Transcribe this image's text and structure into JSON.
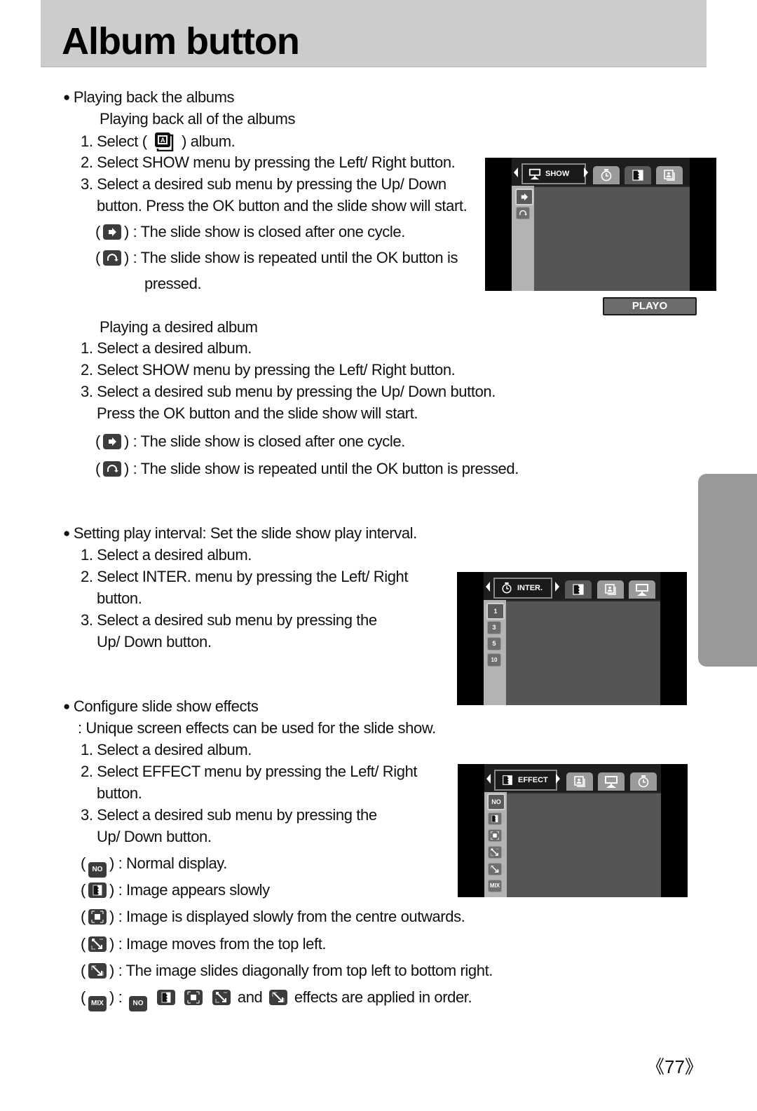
{
  "header": {
    "title": "Album button"
  },
  "section1": {
    "heading": "Playing back the albums",
    "sub1": {
      "title": "Playing back all of the albums",
      "step1_pre": "1. Select (",
      "step1_post": ") album.",
      "step2": "2. Select SHOW menu by pressing the Left/ Right button.",
      "step3a": "3. Select a desired sub menu by pressing the Up/ Down",
      "step3b": "button. Press the OK button and the slide show will start.",
      "opt1": ") : The slide show is closed after one cycle.",
      "opt2a": ") : The slide show is repeated until the OK button is",
      "opt2b": "pressed."
    },
    "sub2": {
      "title": "Playing a desired album",
      "step1": "1. Select a desired album.",
      "step2": "2. Select SHOW menu by pressing the Left/ Right button.",
      "step3a": "3. Select a desired sub menu by pressing the Up/ Down button.",
      "step3b": "Press the OK button and the slide show will start.",
      "opt1": ") : The slide show is closed after one cycle.",
      "opt2": ") : The slide show is repeated until the OK button is pressed."
    },
    "open_paren": "(",
    "screen": {
      "selected_tab": "SHOW",
      "selected_icon": "slideshow-icon",
      "tabs": [
        "timer-icon",
        "effect-icon",
        "album-icon"
      ],
      "sub_items": [
        "play-once-icon",
        "repeat-icon"
      ],
      "button": "PLAYO"
    }
  },
  "section2": {
    "heading": "Setting play interval: Set the slide show play interval.",
    "step1": "1. Select a desired album.",
    "step2a": "2. Select INTER. menu by pressing the Left/ Right",
    "step2b": "button.",
    "step3a": "3. Select a desired sub menu by pressing the",
    "step3b": "Up/ Down button.",
    "screen": {
      "selected_tab": "INTER.",
      "selected_icon": "timer-icon",
      "tabs": [
        "effect-icon",
        "album-icon",
        "slideshow-icon"
      ],
      "sub_items": [
        "1",
        "3",
        "5",
        "10"
      ]
    }
  },
  "section3": {
    "heading": "Configure slide show effects",
    "desc": ": Unique screen effects can be used for the slide show.",
    "step1": "1. Select a desired album.",
    "step2a": "2. Select EFFECT menu by pressing the Left/ Right",
    "step2b": "button.",
    "step3a": "3. Select a desired sub menu by pressing the",
    "step3b": "Up/ Down button.",
    "effects": [
      {
        "icon": "NO",
        "desc": ") : Normal display."
      },
      {
        "icon": "fade",
        "desc": ") : Image appears slowly"
      },
      {
        "icon": "centre",
        "desc": ") : Image is displayed slowly from the centre outwards."
      },
      {
        "icon": "topleft",
        "desc": ") : Image moves from the top left."
      },
      {
        "icon": "diagonal",
        "desc": ") : The image slides diagonally from top left to bottom right."
      },
      {
        "icon": "MIX",
        "desc_pre": ") : ",
        "and": "and",
        "desc_post": "effects are applied in order."
      }
    ],
    "screen": {
      "selected_tab": "EFFECT",
      "selected_icon": "effect-icon",
      "tabs": [
        "album-icon",
        "slideshow-icon",
        "timer-icon"
      ],
      "sub_items": [
        "NO",
        "fade",
        "centre",
        "topleft",
        "diagonal",
        "MIX"
      ]
    }
  },
  "page_number": "《77》"
}
